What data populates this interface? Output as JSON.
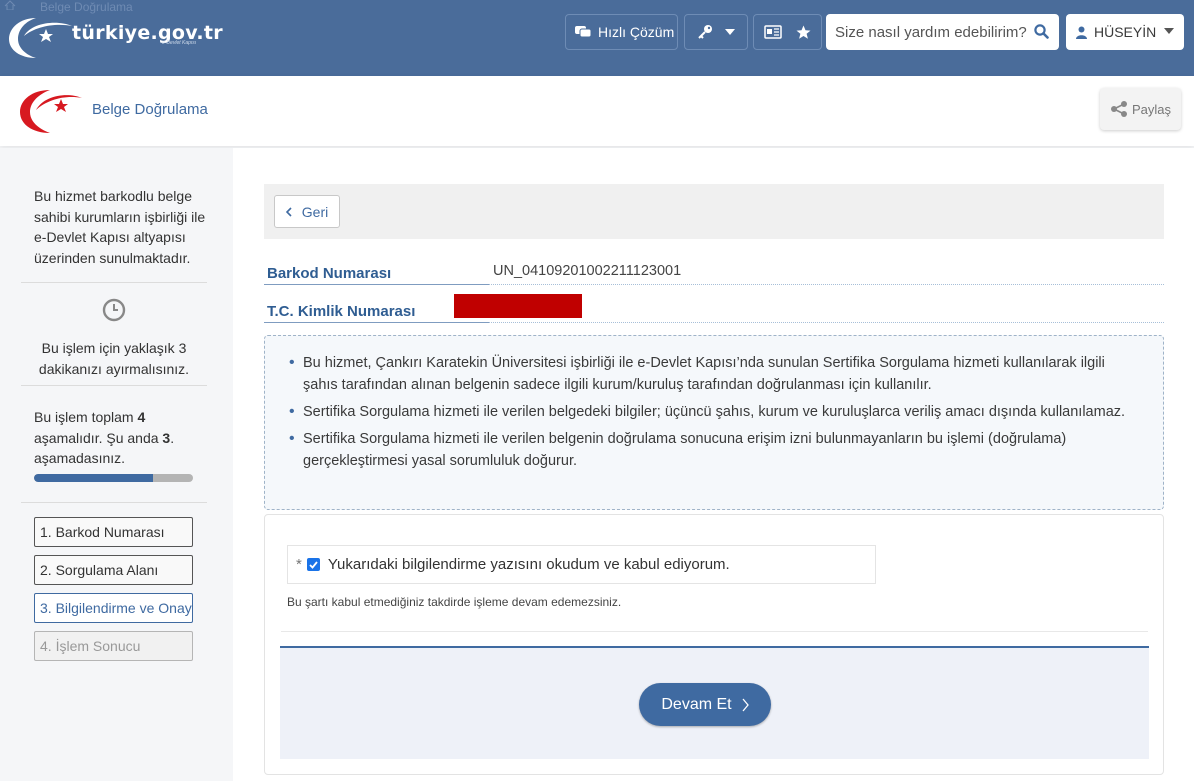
{
  "topbar": {
    "breadcrumb": "Belge Doğrulama",
    "logo_text": "türkiye.gov.tr",
    "logo_tagline": "e-Devlet Kapısı",
    "quick_solution_label": "Hızlı Çözüm",
    "search_placeholder": "Size nasıl yardım edebilirim?",
    "user_name": "HÜSEYİN"
  },
  "subheader": {
    "title": "Belge Doğrulama",
    "share_label": "Paylaş"
  },
  "sidebar": {
    "description": "Bu hizmet barkodlu belge sahibi kurumların işbirliği ile e-Devlet Kapısı altyapısı üzerinden sunulmaktadır.",
    "time_text": "Bu işlem için yaklaşık 3 dakikanızı ayırmalısınız.",
    "steps_text_a": "Bu işlem toplam ",
    "steps_total": "4",
    "steps_text_b": " aşamalıdır. Şu anda ",
    "steps_current": "3",
    "steps_text_c": ". aşamadasınız.",
    "progress": 0.75,
    "steps": [
      "1. Barkod Numarası",
      "2. Sorgulama Alanı",
      "3. Bilgilendirme ve Onay",
      "4. İşlem Sonucu"
    ]
  },
  "main": {
    "back_label": "Geri",
    "barcode_label": "Barkod Numarası",
    "barcode_value": "UN_04109201002211123001",
    "tc_label": "T.C. Kimlik Numarası",
    "notices": [
      "Bu hizmet, Çankırı Karatekin Üniversitesi işbirliği ile e-Devlet Kapısı’nda sunulan Sertifika Sorgulama hizmeti kullanılarak ilgili şahıs tarafından alınan belgenin sadece ilgili kurum/kuruluş tarafından doğrulanması için kullanılır.",
      "Sertifika Sorgulama hizmeti ile verilen belgedeki bilgiler; üçüncü şahıs, kurum ve kuruluşlarca veriliş amacı dışında kullanılamaz.",
      "Sertifika Sorgulama hizmeti ile verilen belgenin doğrulama sonucuna erişim izni bulunmayanların bu işlemi (doğrulama) gerçekleştirmesi yasal sorumluluk doğurur."
    ],
    "required_mark": "*",
    "checkbox_label": "Yukarıdaki bilgilendirme yazısını okudum ve kabul ediyorum.",
    "checkbox_checked": true,
    "hint": "Bu şartı kabul etmediğiniz takdirde işleme devam edemezsiniz.",
    "continue_label": "Devam Et"
  },
  "colors": {
    "header": "#4a6c9a",
    "accent": "#3f6aa1",
    "redaction": "#c00000",
    "logo_red": "#d71920"
  }
}
